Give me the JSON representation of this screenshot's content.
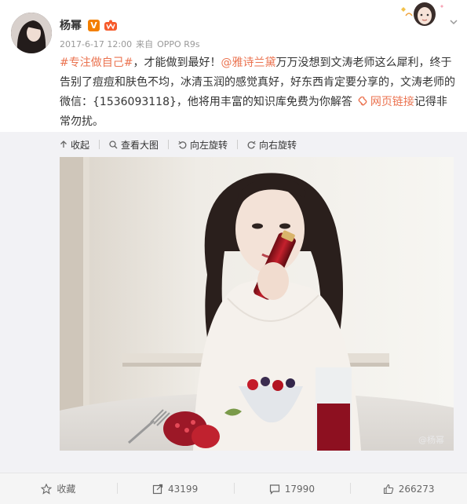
{
  "post": {
    "user_name": "杨幂",
    "verified_badge": "V",
    "timestamp": "2017-6-17 12:00",
    "source_prefix": "来自",
    "source_device": "OPPO R9s"
  },
  "content": {
    "hashtag": "#专注做自己#",
    "text1": "，才能做到最好！",
    "mention": "@雅诗兰黛",
    "text2": "万万没想到文涛老师这么犀利，终于告别了痘痘和肤色不均，冰清玉润的感觉真好，好东西肯定要分享的，文涛老师的微信：{1536093118}，他将用丰富的知识库免费为你解答",
    "link_text": "网页链接",
    "text3": "记得非常勿扰。"
  },
  "image_toolbar": {
    "collapse": "收起",
    "view_large": "查看大图",
    "rotate_left": "向左旋转",
    "rotate_right": "向右旋转"
  },
  "image": {
    "watermark": "@杨幂"
  },
  "footer": {
    "favorite": "收藏",
    "repost_count": "43199",
    "comment_count": "17990",
    "like_count": "266273"
  },
  "colors": {
    "link": "#eb7350",
    "verified": "#f37f00",
    "expanded_bg": "#f2f2f5"
  }
}
